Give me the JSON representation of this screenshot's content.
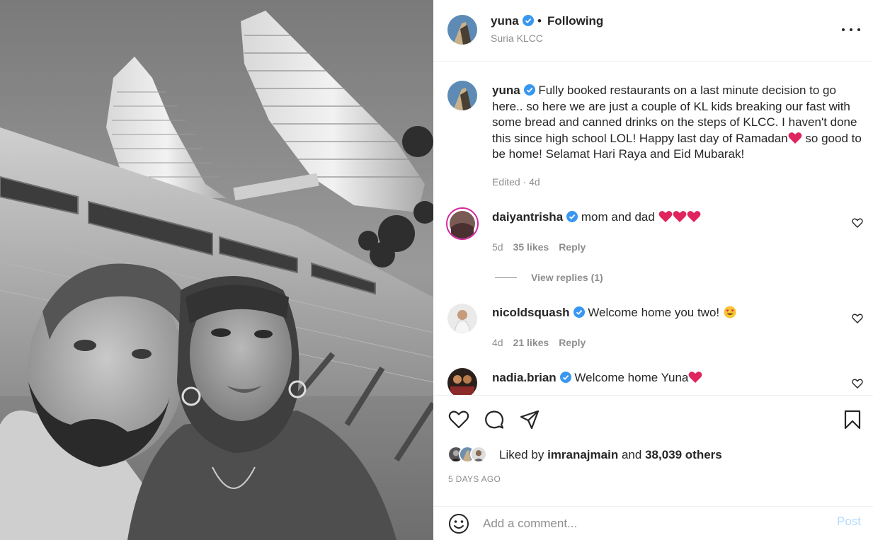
{
  "post": {
    "username": "yuna",
    "follow_separator": "•",
    "follow_label": "Following",
    "location": "Suria KLCC"
  },
  "caption": {
    "username": "yuna",
    "text_part1": "Fully booked restaurants on a last minute decision to go here.. so here we are just a couple of KL kids breaking our fast with some bread and canned drinks on the steps of KLCC. I haven't done this since high school LOL! Happy last day of Ramadan",
    "text_part2": " so good to be home! Selamat Hari Raya and Eid Mubarak!",
    "meta": "Edited · 4d"
  },
  "comments": [
    {
      "username": "daiyantrisha",
      "text": "mom and dad",
      "age": "5d",
      "likes": "35 likes",
      "reply": "Reply",
      "view_replies": "View replies (1)"
    },
    {
      "username": "nicoldsquash",
      "text": "Welcome home you two!",
      "age": "4d",
      "likes": "21 likes",
      "reply": "Reply"
    },
    {
      "username": "nadia.brian",
      "text": "Welcome home Yuna"
    }
  ],
  "likes": {
    "prefix": "Liked by",
    "user": "imranajmain",
    "middle": "and",
    "others": "38,039 others"
  },
  "date": "5 DAYS AGO",
  "comment_box": {
    "placeholder": "Add a comment...",
    "post_label": "Post"
  },
  "icons": {
    "verified": "verified-badge-icon",
    "heart": "heart-icon",
    "comment": "comment-icon",
    "share": "share-icon",
    "save": "bookmark-icon",
    "emoji": "emoji-icon",
    "more": "more-options-icon"
  },
  "colors": {
    "verified_blue": "#3897f0",
    "text_primary": "#262626",
    "text_secondary": "#8e8e8e",
    "post_disabled": "#b3dbff",
    "heart_red": "#e0245e"
  }
}
